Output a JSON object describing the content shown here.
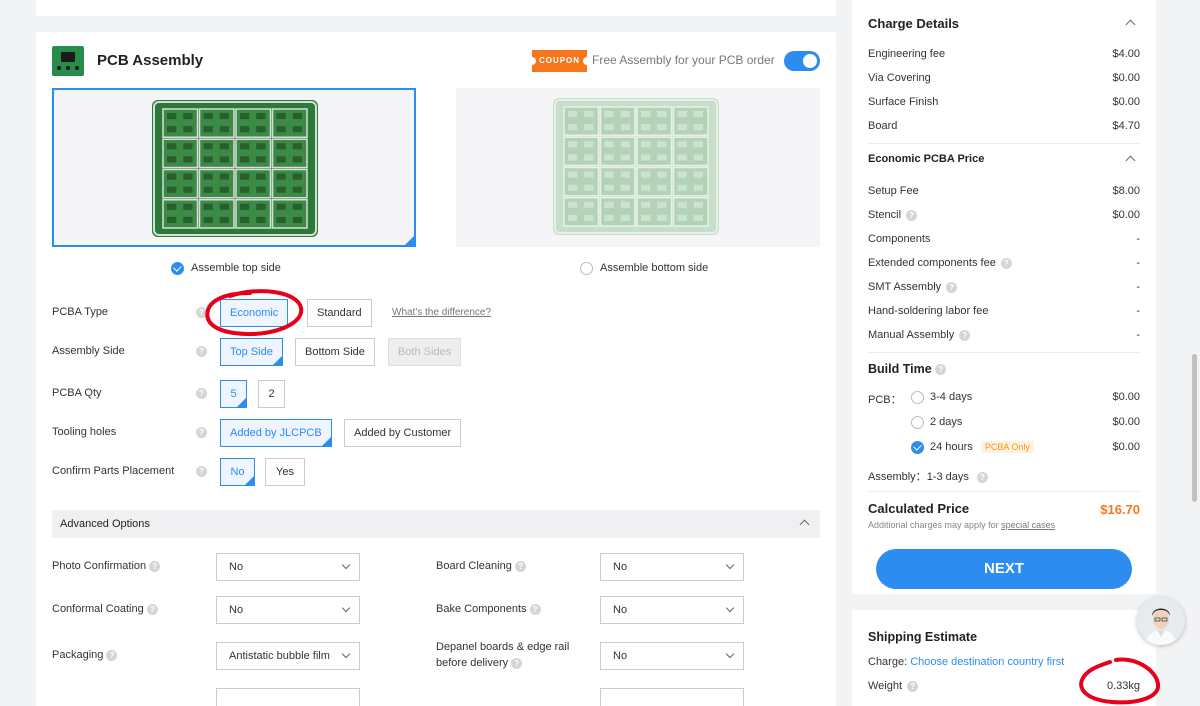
{
  "pcb_assembly": {
    "title": "PCB Assembly",
    "coupon_label": "COUPON",
    "coupon_text": "Free Assembly for your PCB order",
    "toggle_on": true
  },
  "sides": {
    "top_label": "Assemble top side",
    "bottom_label": "Assemble bottom side"
  },
  "form": {
    "pcba_type": {
      "label": "PCBA Type",
      "options": [
        "Economic",
        "Standard"
      ],
      "selected": "Economic",
      "diff_link": "What's the difference?"
    },
    "assembly_side": {
      "label": "Assembly Side",
      "options": [
        "Top Side",
        "Bottom Side",
        "Both Sides"
      ],
      "selected": "Top Side"
    },
    "pcba_qty": {
      "label": "PCBA Qty",
      "options": [
        "5",
        "2"
      ],
      "selected": "5"
    },
    "tooling_holes": {
      "label": "Tooling holes",
      "options": [
        "Added by JLCPCB",
        "Added by Customer"
      ],
      "selected": "Added by JLCPCB"
    },
    "confirm_parts": {
      "label": "Confirm Parts Placement",
      "options": [
        "No",
        "Yes"
      ],
      "selected": "No"
    }
  },
  "advanced": {
    "title": "Advanced Options",
    "photo_confirmation": {
      "label": "Photo Confirmation",
      "value": "No"
    },
    "board_cleaning": {
      "label": "Board Cleaning",
      "value": "No"
    },
    "conformal_coating": {
      "label": "Conformal Coating",
      "value": "No"
    },
    "bake_components": {
      "label": "Bake Components",
      "value": "No"
    },
    "packaging": {
      "label": "Packaging",
      "value": "Antistatic bubble film"
    },
    "depanel": {
      "label_line1": "Depanel boards & edge rail",
      "label_line2": "before delivery",
      "value": "No"
    }
  },
  "charges": {
    "title": "Charge Details",
    "rows": [
      {
        "label": "Engineering fee",
        "value": "$4.00"
      },
      {
        "label": "Via Covering",
        "value": "$0.00"
      },
      {
        "label": "Surface Finish",
        "value": "$0.00"
      },
      {
        "label": "Board",
        "value": "$4.70"
      }
    ]
  },
  "economic_pcba": {
    "title": "Economic PCBA Price",
    "rows": [
      {
        "label": "Setup Fee",
        "value": "$8.00"
      },
      {
        "label": "Stencil",
        "value": "$0.00"
      },
      {
        "label": "Components",
        "value": "-"
      },
      {
        "label": "Extended components fee",
        "value": "-"
      },
      {
        "label": "SMT Assembly",
        "value": "-"
      },
      {
        "label": "Hand-soldering labor fee",
        "value": "-"
      },
      {
        "label": "Manual Assembly",
        "value": "-"
      }
    ]
  },
  "build_time": {
    "title": "Build Time",
    "pcb_label": "PCB：",
    "options": [
      {
        "label": "3-4 days",
        "value": "$0.00",
        "selected": false
      },
      {
        "label": "2 days",
        "value": "$0.00",
        "selected": false
      },
      {
        "label": "24 hours",
        "value": "$0.00",
        "selected": true,
        "badge": "PCBA Only"
      }
    ],
    "assembly_label": "Assembly：",
    "assembly_value": "1-3 days"
  },
  "total": {
    "label": "Calculated Price",
    "value": "$16.70",
    "note": "Additional charges may apply for",
    "note_link": "special cases",
    "next_label": "NEXT"
  },
  "shipping": {
    "title": "Shipping Estimate",
    "charge_label": "Charge:",
    "charge_link": "Choose destination country first",
    "weight_label": "Weight",
    "weight_value": "0.33kg"
  },
  "colors": {
    "accent": "#2d8cf0",
    "price": "#f7761b",
    "annotation": "#e8001a",
    "pcb_green": "#2b7a3a"
  }
}
